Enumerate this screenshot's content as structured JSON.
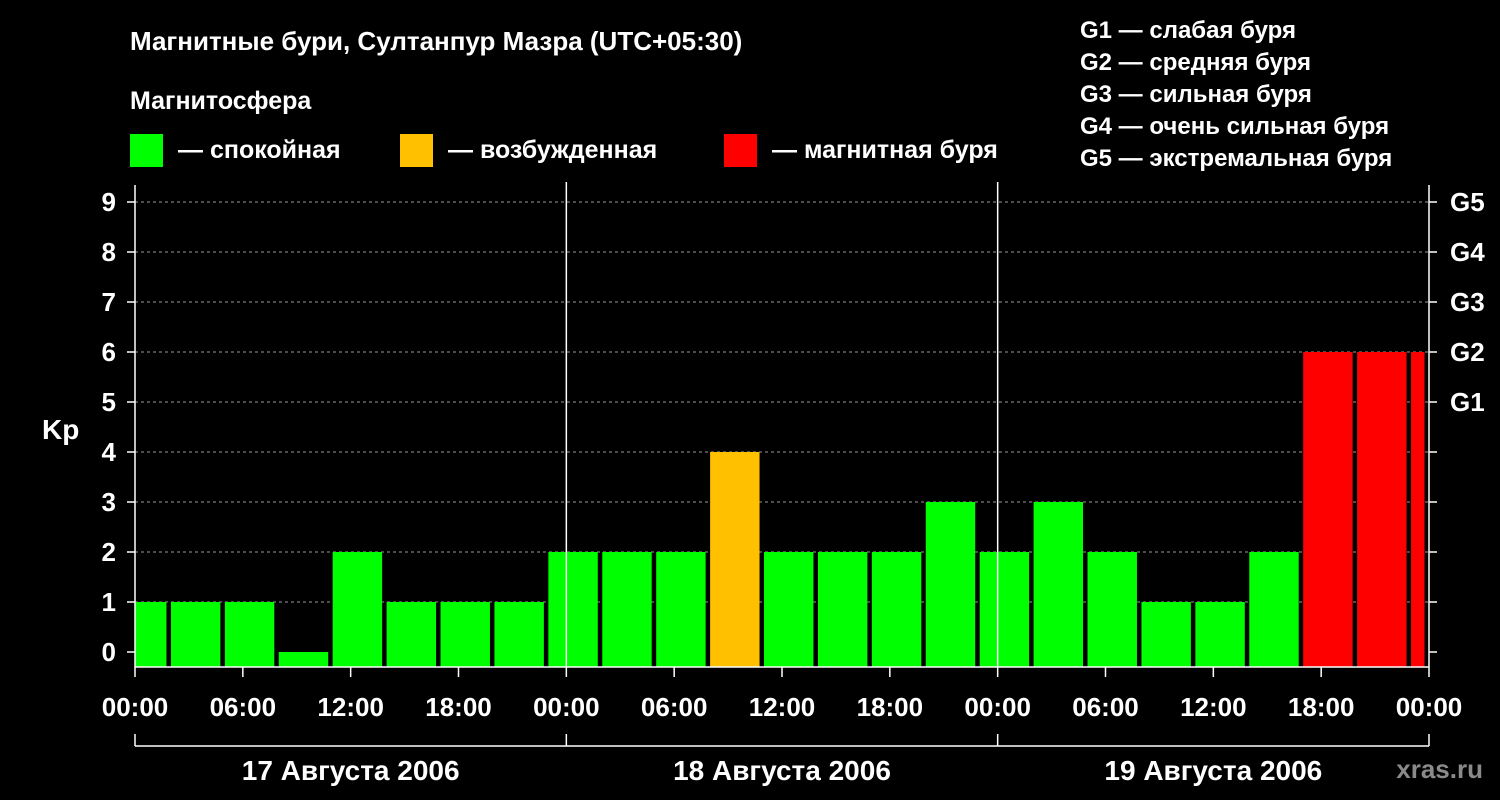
{
  "chart_data": {
    "type": "bar",
    "title": "Магнитные бури, Султанпур Мазра (UTC+05:30)",
    "legend_title": "Магнитосфера",
    "legend": [
      {
        "label": "— спокойная",
        "color": "#00ff00"
      },
      {
        "label": "— возбужденная",
        "color": "#ffc000"
      },
      {
        "label": "— магнитная буря",
        "color": "#ff0000"
      }
    ],
    "storm_scale": [
      "G1 — слабая буря",
      "G2 — средняя буря",
      "G3 — сильная буря",
      "G4 — очень сильная буря",
      "G5 — экстремальная буря"
    ],
    "ylabel": "Kp",
    "ylim": [
      0,
      9
    ],
    "y_ticks": [
      0,
      1,
      2,
      3,
      4,
      5,
      6,
      7,
      8,
      9
    ],
    "right_ticks": [
      {
        "kp": 5,
        "label": "G1"
      },
      {
        "kp": 6,
        "label": "G2"
      },
      {
        "kp": 7,
        "label": "G3"
      },
      {
        "kp": 8,
        "label": "G4"
      },
      {
        "kp": 9,
        "label": "G5"
      }
    ],
    "x_ticks": [
      "00:00",
      "06:00",
      "12:00",
      "18:00",
      "00:00",
      "06:00",
      "12:00",
      "18:00",
      "00:00",
      "06:00",
      "12:00",
      "18:00",
      "00:00"
    ],
    "days": [
      "17 Августа 2006",
      "18 Августа 2006",
      "19 Августа 2006"
    ],
    "x_start_hours": 0,
    "x_end_hours": 72,
    "bars": [
      {
        "start": 0,
        "end": 1.75,
        "kp": 1,
        "status": "quiet"
      },
      {
        "start": 2,
        "end": 4.75,
        "kp": 1,
        "status": "quiet"
      },
      {
        "start": 5,
        "end": 7.75,
        "kp": 1,
        "status": "quiet"
      },
      {
        "start": 8,
        "end": 10.75,
        "kp": 0,
        "status": "quiet"
      },
      {
        "start": 11,
        "end": 13.75,
        "kp": 2,
        "status": "quiet"
      },
      {
        "start": 14,
        "end": 16.75,
        "kp": 1,
        "status": "quiet"
      },
      {
        "start": 17,
        "end": 19.75,
        "kp": 1,
        "status": "quiet"
      },
      {
        "start": 20,
        "end": 22.75,
        "kp": 1,
        "status": "quiet"
      },
      {
        "start": 23,
        "end": 25.75,
        "kp": 2,
        "status": "quiet"
      },
      {
        "start": 26,
        "end": 28.75,
        "kp": 2,
        "status": "quiet"
      },
      {
        "start": 29,
        "end": 31.75,
        "kp": 2,
        "status": "quiet"
      },
      {
        "start": 32,
        "end": 34.75,
        "kp": 4,
        "status": "active"
      },
      {
        "start": 35,
        "end": 37.75,
        "kp": 2,
        "status": "quiet"
      },
      {
        "start": 38,
        "end": 40.75,
        "kp": 2,
        "status": "quiet"
      },
      {
        "start": 41,
        "end": 43.75,
        "kp": 2,
        "status": "quiet"
      },
      {
        "start": 44,
        "end": 46.75,
        "kp": 3,
        "status": "quiet"
      },
      {
        "start": 47,
        "end": 49.75,
        "kp": 2,
        "status": "quiet"
      },
      {
        "start": 50,
        "end": 52.75,
        "kp": 3,
        "status": "quiet"
      },
      {
        "start": 53,
        "end": 55.75,
        "kp": 2,
        "status": "quiet"
      },
      {
        "start": 56,
        "end": 58.75,
        "kp": 1,
        "status": "quiet"
      },
      {
        "start": 59,
        "end": 61.75,
        "kp": 1,
        "status": "quiet"
      },
      {
        "start": 62,
        "end": 64.75,
        "kp": 2,
        "status": "quiet"
      },
      {
        "start": 65,
        "end": 67.75,
        "kp": 6,
        "status": "storm"
      },
      {
        "start": 68,
        "end": 70.75,
        "kp": 6,
        "status": "storm"
      },
      {
        "start": 71,
        "end": 71.75,
        "kp": 6,
        "status": "storm"
      }
    ],
    "status_colors": {
      "quiet": "#00ff00",
      "active": "#ffc000",
      "storm": "#ff0000"
    },
    "grid": true,
    "watermark": "xras.ru"
  }
}
